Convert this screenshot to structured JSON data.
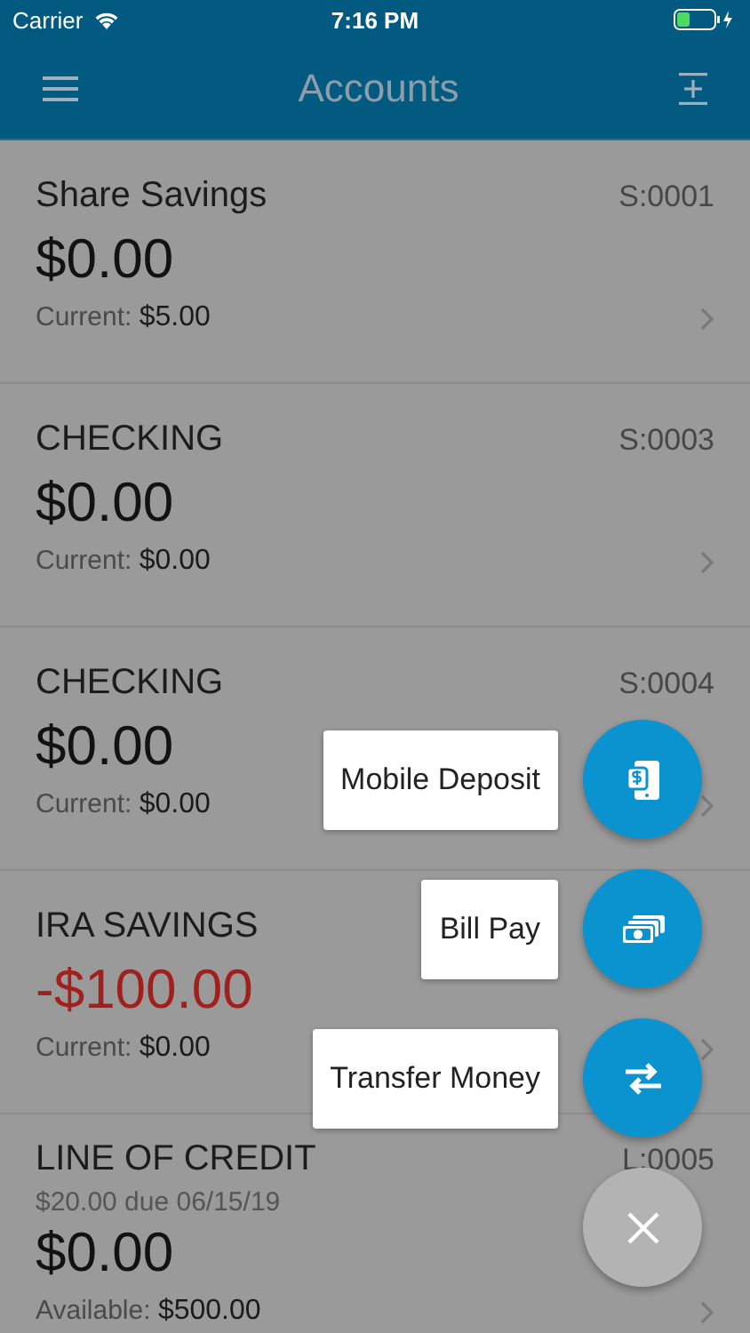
{
  "status_bar": {
    "carrier": "Carrier",
    "time": "7:16 PM"
  },
  "header": {
    "title": "Accounts"
  },
  "accounts": [
    {
      "name": "Share Savings",
      "code": "S:0001",
      "amount": "$0.00",
      "negative": false,
      "detail_label": "Current:",
      "detail_value": "$5.00"
    },
    {
      "name": "CHECKING",
      "code": "S:0003",
      "amount": "$0.00",
      "negative": false,
      "detail_label": "Current:",
      "detail_value": "$0.00"
    },
    {
      "name": "CHECKING",
      "code": "S:0004",
      "amount": "$0.00",
      "negative": false,
      "detail_label": "Current:",
      "detail_value": "$0.00"
    },
    {
      "name": "IRA SAVINGS",
      "amount": "-$100.00",
      "negative": true,
      "detail_label": "Current:",
      "detail_value": "$0.00"
    },
    {
      "name": "LINE OF CREDIT",
      "code": "L:0005",
      "due": "$20.00 due 06/15/19",
      "amount": "$0.00",
      "negative": false,
      "detail_label": "Available:",
      "detail_value": "$500.00"
    }
  ],
  "actions": [
    {
      "label": "Mobile Deposit",
      "kind": "deposit"
    },
    {
      "label": "Bill Pay",
      "kind": "bill"
    },
    {
      "label": "Transfer Money",
      "kind": "transfer"
    }
  ]
}
